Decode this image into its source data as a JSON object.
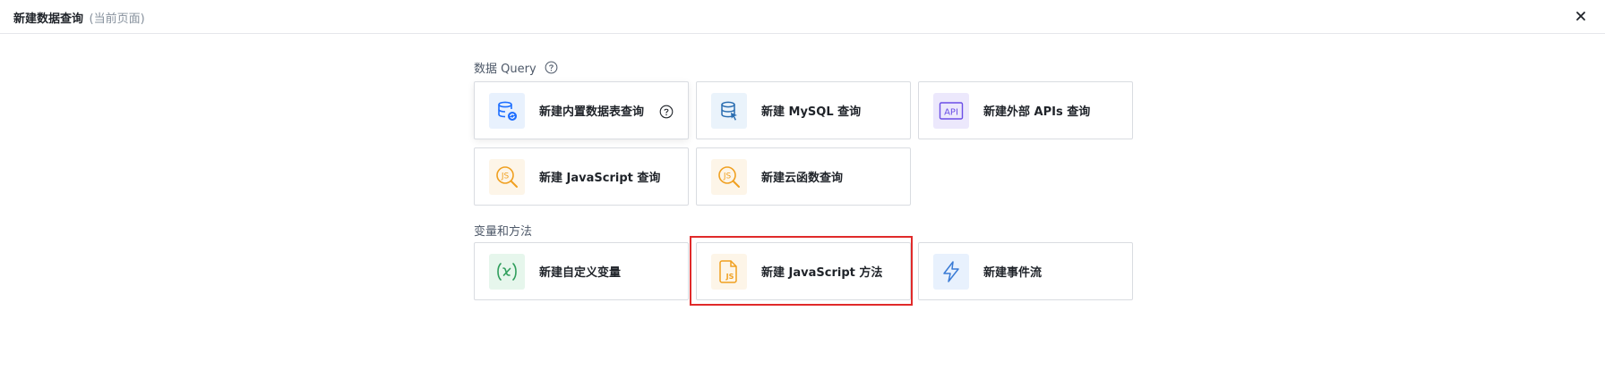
{
  "header": {
    "title": "新建数据查询",
    "subtitle": "(当前页面)",
    "close_icon": "close-icon"
  },
  "sections": {
    "query": {
      "label": "数据 Query",
      "help_icon": "question-circle-icon"
    },
    "vars": {
      "label": "变量和方法"
    }
  },
  "cards": {
    "builtin_table": {
      "label": "新建内置数据表查询",
      "icon": "database-sync-icon",
      "color": "#1e6fff"
    },
    "mysql": {
      "label": "新建 MySQL 查询",
      "icon": "database-cursor-icon",
      "color": "#2a6db0"
    },
    "external_api": {
      "label": "新建外部 APIs 查询",
      "icon": "api-icon",
      "color": "#6b4ee6"
    },
    "javascript_query": {
      "label": "新建 JavaScript 查询",
      "icon": "js-search-icon",
      "color": "#f0a020"
    },
    "cloud_function": {
      "label": "新建云函数查询",
      "icon": "js-search-icon",
      "color": "#f0a020"
    },
    "custom_variable": {
      "label": "新建自定义变量",
      "icon": "variable-x-icon",
      "color": "#2f9e5c"
    },
    "javascript_method": {
      "label": "新建 JavaScript 方法",
      "icon": "js-file-icon",
      "color": "#f0a020"
    },
    "event_flow": {
      "label": "新建事件流",
      "icon": "lightning-icon",
      "color": "#3a7bd5"
    }
  }
}
